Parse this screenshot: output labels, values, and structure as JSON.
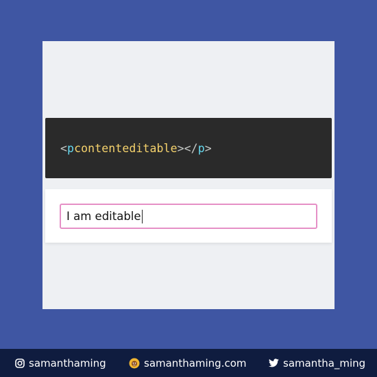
{
  "code_snippet": {
    "open_bracket": "<",
    "tag_open": "p",
    "attribute": "contenteditable",
    "close_open": "></",
    "tag_close": "p",
    "end_bracket": ">"
  },
  "demo": {
    "editable_text": "I am editable"
  },
  "footer": {
    "instagram": {
      "icon": "instagram-icon",
      "label": "samanthaming"
    },
    "website": {
      "icon": "website-logo-icon",
      "label": "samanthaming.com"
    },
    "twitter": {
      "icon": "twitter-icon",
      "label": "samantha_ming"
    }
  },
  "colors": {
    "background": "#3f56a3",
    "card": "#eef0f3",
    "code_bg": "#2a2a2a",
    "tag": "#66d9ef",
    "attribute": "#f5d26c",
    "editable_border": "#e58fc6",
    "footer_bg": "#0f1c3f"
  }
}
